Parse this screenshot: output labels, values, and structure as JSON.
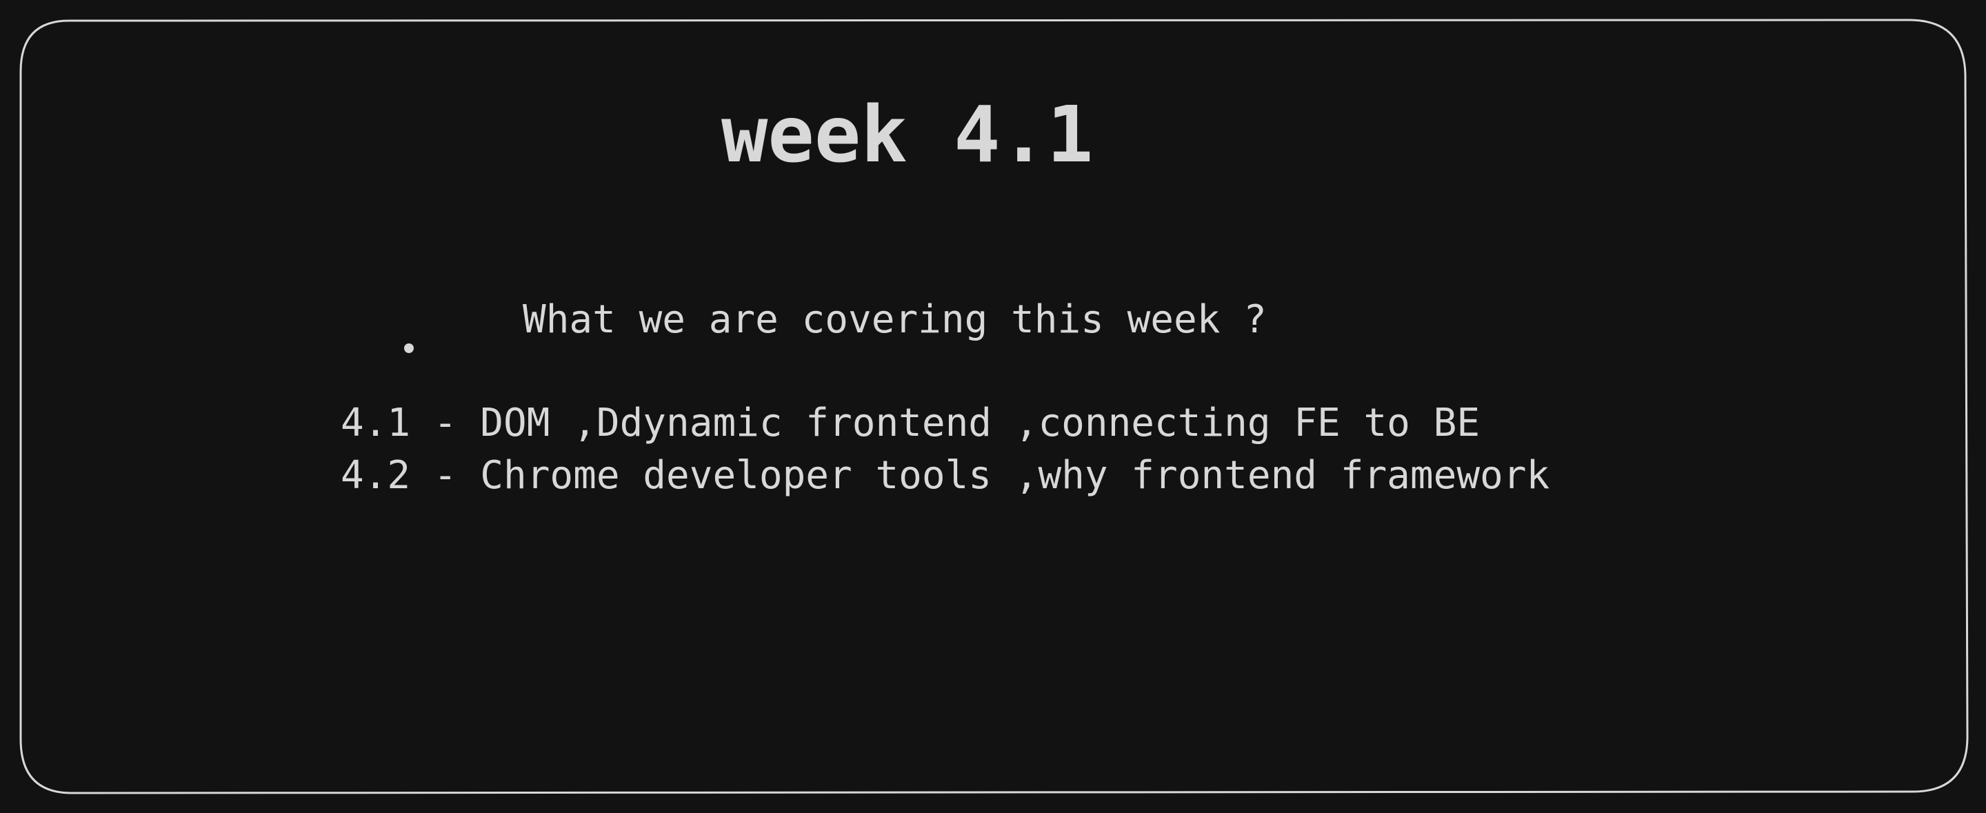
{
  "title": "week 4.1",
  "subtitle": "What we are covering this week ?",
  "items": [
    "4.1 - DOM ,Ddynamic frontend ,connecting FE to BE",
    "4.2 - Chrome developer tools ,why frontend framework"
  ],
  "colors": {
    "background": "#121212",
    "stroke": "#d8d8d8",
    "text": "#d8d8d8"
  }
}
